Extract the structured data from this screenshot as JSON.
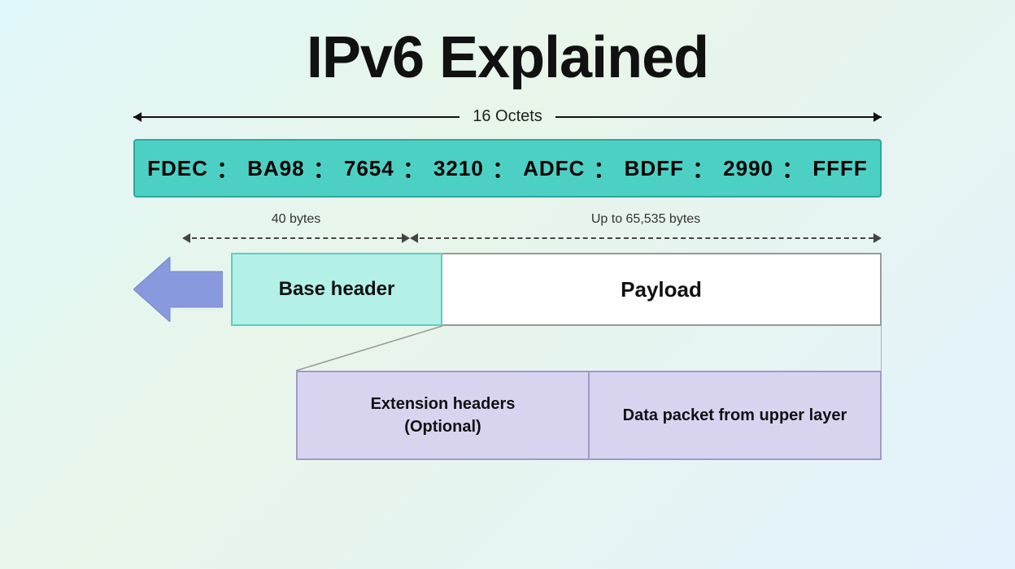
{
  "title": "IPv6 Explained",
  "octets_label": "16 Octets",
  "ipv6_address": {
    "segments": [
      "FDEC",
      "BA98",
      "7654",
      "3210",
      "ADFC",
      "BDFF",
      "2990",
      "FFFF"
    ]
  },
  "forty_bytes_label": "40 bytes",
  "upto_label": "Up to 65,535 bytes",
  "base_header_label": "Base header",
  "payload_label": "Payload",
  "ext_headers_label": "Extension headers\n(Optional)",
  "data_packet_label": "Data packet from upper layer"
}
